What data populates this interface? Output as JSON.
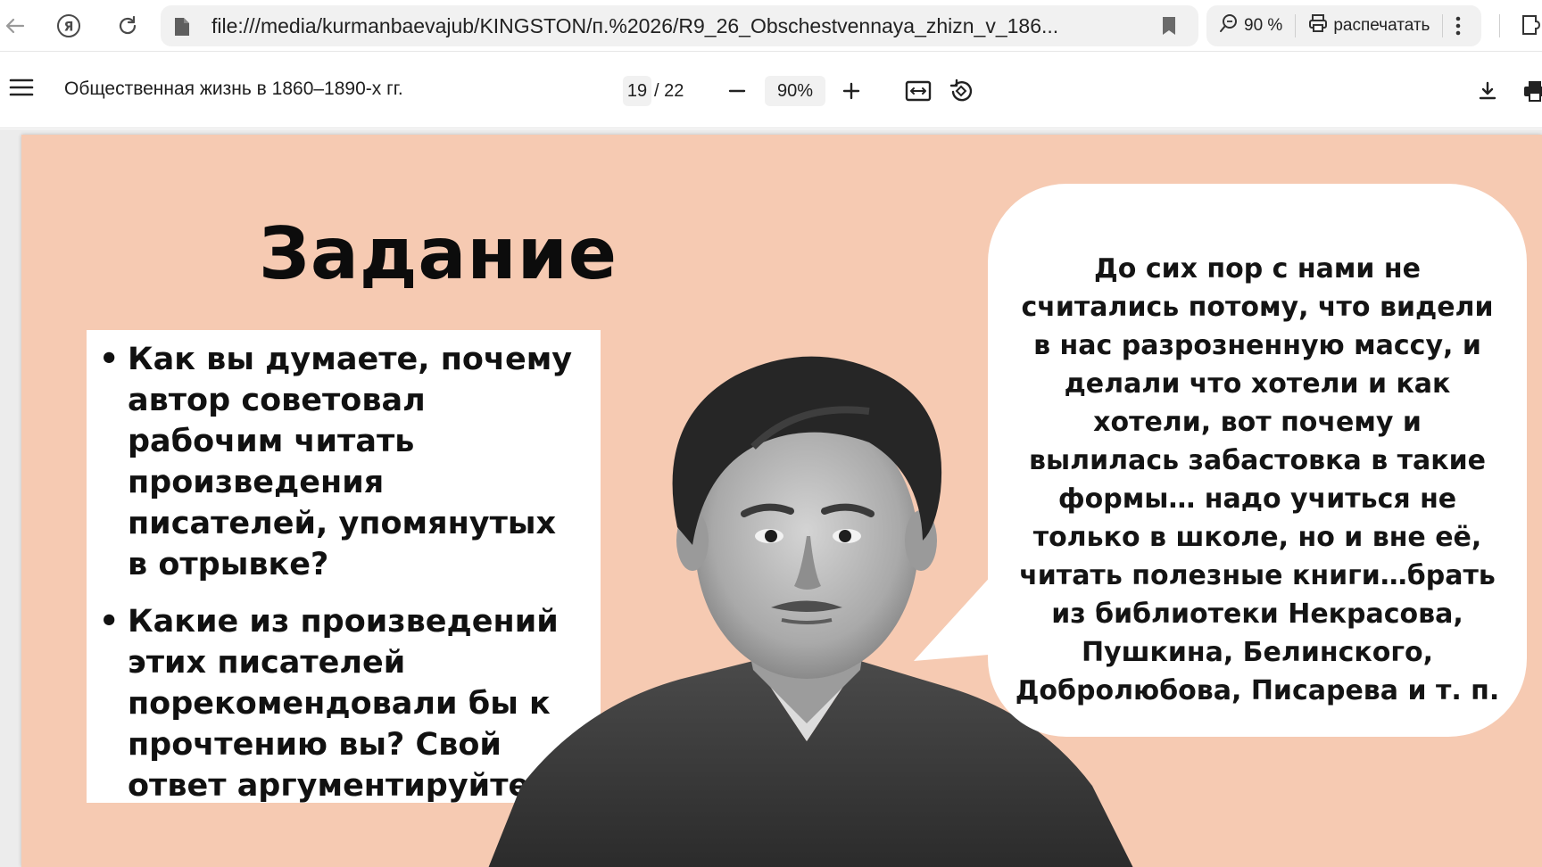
{
  "browser": {
    "url": "file:///media/kurmanbaevajub/KINGSTON/п.%2026/R9_26_Obschestvennaya_zhizn_v_186...",
    "zoom_label": "90 %",
    "print_label": "распечатать"
  },
  "pdf_toolbar": {
    "doc_title": "Общественная жизнь в 1860–1890-х гг.",
    "current_page": "19",
    "total_pages": "/ 22",
    "zoom": "90%"
  },
  "slide": {
    "title": "Задание",
    "questions": [
      "Как вы думаете, почему автор советовал рабочим читать произведения писателей, упомянутых в отрывке?",
      "Какие из произведений этих писателей порекомендовали бы к прочтению вы? Свой ответ аргументируйте."
    ],
    "quote": "До сих пор с нами не считались потому, что видели в нас разрозненную массу, и делали что хотели и как хотели, вот почему и вылилась забастовка в такие формы… надо учиться не только в школе, но и вне её, читать полезные книги…брать из библиотеки Некрасова, Пушкина, Белинского, Добролюбова, Писарева и т. п."
  },
  "colors": {
    "slide_background": "#f6cab2",
    "toolbar_background": "#ffffff",
    "field_background": "#f1f1f1"
  },
  "icons": [
    "back-arrow-icon",
    "yandex-icon",
    "reload-icon",
    "file-icon",
    "bookmark-icon",
    "zoom-search-icon",
    "printer-icon",
    "more-vertical-icon",
    "extensions-icon",
    "hamburger-menu-icon",
    "minus-icon",
    "plus-icon",
    "fit-width-icon",
    "rotate-icon",
    "download-icon",
    "print-icon"
  ]
}
